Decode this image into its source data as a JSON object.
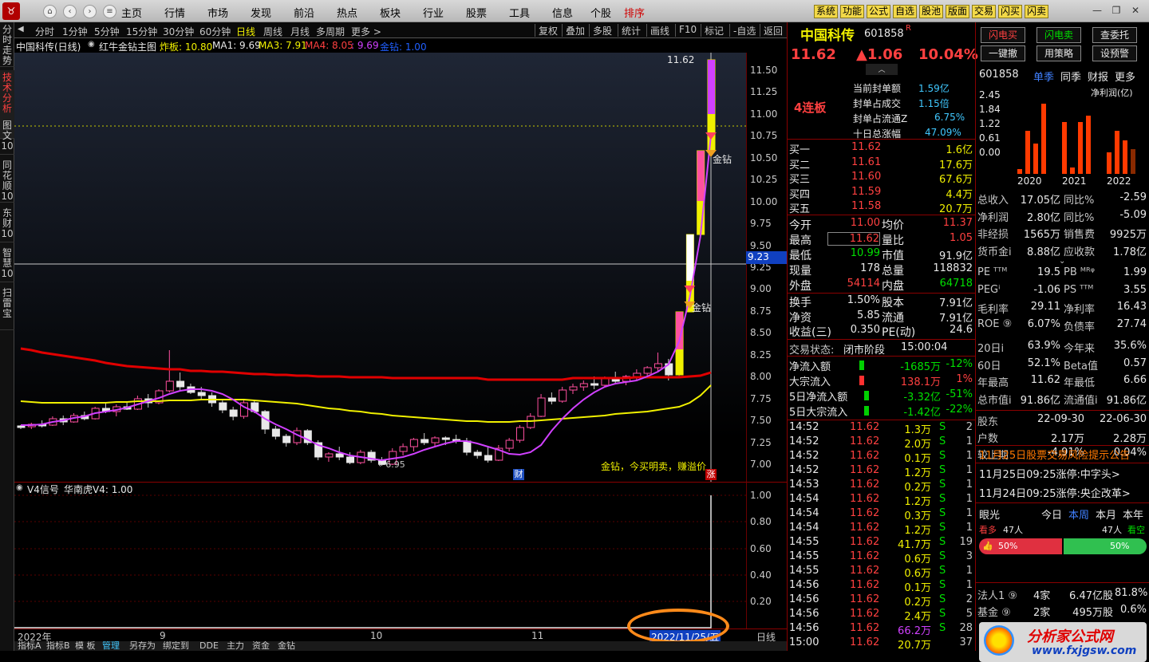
{
  "topbar": {
    "logo": "♉",
    "menus": [
      "主页",
      "行情",
      "市场",
      "发现",
      "前沿",
      "热点",
      "板块",
      "行业",
      "股票",
      "工具",
      "信息",
      "个股",
      "排序"
    ],
    "quick": [
      "系统",
      "功能",
      "公式",
      "自选",
      "股池",
      "版面",
      "交易",
      "闪买",
      "闪卖"
    ],
    "win_min": "—",
    "win_max": "❐",
    "win_close": "✕"
  },
  "sidebar": {
    "tabs": [
      "分时走势",
      "技术分析",
      "图文10",
      "同花顺10",
      "东财10",
      "智慧10",
      "扫雷宝"
    ]
  },
  "chartbar": {
    "periods": [
      "分时",
      "1分钟",
      "5分钟",
      "15分钟",
      "30分钟",
      "60分钟",
      "日线",
      "周线",
      "月线",
      "多周期",
      "更多 >"
    ],
    "tools": [
      "复权",
      "叠加",
      "多股",
      "统计",
      "画线",
      "F10",
      "标记",
      "-自选",
      "返回"
    ]
  },
  "infobar": {
    "stock": "中国科传(日线)",
    "indicator": "红牛金钻主图",
    "zb": "炸板: 10.80",
    "ma1": "MA1: 9.69",
    "ma3": "MA3: 7.91",
    "ma4": "MA4: 8.05",
    "ma4b": ": 9.69",
    "jz": "金钻: 1.00"
  },
  "chart_data": [
    {
      "type": "candlestick",
      "title": "中国科传(日线)",
      "ylim": [
        6.8,
        11.7
      ],
      "y_ticks": [
        "11.50",
        "11.25",
        "11.00",
        "10.75",
        "10.50",
        "10.25",
        "10.00",
        "9.75",
        "9.50",
        "9.25",
        "9.00",
        "8.75",
        "8.50",
        "8.25",
        "8.00",
        "7.75",
        "7.50",
        "7.25",
        "7.00"
      ],
      "x_ticks": [
        "2022年",
        "9",
        "10",
        "11",
        "2022/11/25/五"
      ],
      "ohlc": [
        [
          7.44,
          7.45,
          7.4,
          7.43
        ],
        [
          7.43,
          7.47,
          7.4,
          7.46
        ],
        [
          7.46,
          7.5,
          7.42,
          7.45
        ],
        [
          7.45,
          7.55,
          7.44,
          7.52
        ],
        [
          7.52,
          7.56,
          7.45,
          7.48
        ],
        [
          7.48,
          7.58,
          7.47,
          7.56
        ],
        [
          7.56,
          7.6,
          7.5,
          7.52
        ],
        [
          7.52,
          7.66,
          7.51,
          7.64
        ],
        [
          7.64,
          7.7,
          7.58,
          7.6
        ],
        [
          7.6,
          7.68,
          7.55,
          7.66
        ],
        [
          7.66,
          7.72,
          7.62,
          7.63
        ],
        [
          7.63,
          7.78,
          7.62,
          7.75
        ],
        [
          7.75,
          7.8,
          7.65,
          7.7
        ],
        [
          7.7,
          7.86,
          7.68,
          7.84
        ],
        [
          7.84,
          8.3,
          7.82,
          7.95
        ],
        [
          7.95,
          8.05,
          7.85,
          7.88
        ],
        [
          7.88,
          7.92,
          7.8,
          7.82
        ],
        [
          7.82,
          7.88,
          7.75,
          7.78
        ],
        [
          7.78,
          7.82,
          7.66,
          7.7
        ],
        [
          7.7,
          7.74,
          7.58,
          7.62
        ],
        [
          7.62,
          7.66,
          7.5,
          7.55
        ],
        [
          7.55,
          7.75,
          7.52,
          7.7
        ],
        [
          7.7,
          7.74,
          7.58,
          7.6
        ],
        [
          7.6,
          7.62,
          7.35,
          7.4
        ],
        [
          7.4,
          7.44,
          7.28,
          7.32
        ],
        [
          7.32,
          7.35,
          7.2,
          7.25
        ],
        [
          7.25,
          7.42,
          7.22,
          7.38
        ],
        [
          7.38,
          7.4,
          7.22,
          7.25
        ],
        [
          7.25,
          7.27,
          7.05,
          7.08
        ],
        [
          7.08,
          7.14,
          7.03,
          7.12
        ],
        [
          7.12,
          7.2,
          7.05,
          7.08
        ],
        [
          7.08,
          7.14,
          7.0,
          7.02
        ],
        [
          7.02,
          7.16,
          7.0,
          7.14
        ],
        [
          7.14,
          7.16,
          7.02,
          7.05
        ],
        [
          7.05,
          7.08,
          6.98,
          7.0
        ],
        [
          7.0,
          7.18,
          6.99,
          7.15
        ],
        [
          7.15,
          7.24,
          7.1,
          7.2
        ],
        [
          7.2,
          7.3,
          7.15,
          7.28
        ],
        [
          7.28,
          7.36,
          7.22,
          7.25
        ],
        [
          7.25,
          7.32,
          7.2,
          7.3
        ],
        [
          7.3,
          7.32,
          7.22,
          7.28
        ],
        [
          7.28,
          7.34,
          7.24,
          7.26
        ],
        [
          7.26,
          7.3,
          7.1,
          7.14
        ],
        [
          7.14,
          7.16,
          7.06,
          7.1
        ],
        [
          7.1,
          7.2,
          7.02,
          7.05
        ],
        [
          7.05,
          7.22,
          7.04,
          7.18
        ],
        [
          7.18,
          7.3,
          7.15,
          7.27
        ],
        [
          7.27,
          7.45,
          7.25,
          7.42
        ],
        [
          7.42,
          7.58,
          7.4,
          7.55
        ],
        [
          7.55,
          7.8,
          7.54,
          7.76
        ],
        [
          7.76,
          7.82,
          7.68,
          7.72
        ],
        [
          7.72,
          7.88,
          7.7,
          7.85
        ],
        [
          7.85,
          7.92,
          7.8,
          7.88
        ],
        [
          7.88,
          7.96,
          7.84,
          7.92
        ],
        [
          7.92,
          8.0,
          7.86,
          7.9
        ],
        [
          7.9,
          8.0,
          7.88,
          7.98
        ],
        [
          7.98,
          8.06,
          7.92,
          7.95
        ],
        [
          7.95,
          8.02,
          7.9,
          8.0
        ],
        [
          8.0,
          8.08,
          7.95,
          8.04
        ],
        [
          8.04,
          8.12,
          8.0,
          8.1
        ],
        [
          8.1,
          8.28,
          8.06,
          8.15
        ],
        [
          8.15,
          8.2,
          7.96,
          8.02
        ],
        [
          8.02,
          8.74,
          8.0,
          8.74
        ],
        [
          8.74,
          9.62,
          8.74,
          9.62
        ],
        [
          9.62,
          10.58,
          10.25,
          10.58
        ],
        [
          10.58,
          11.62,
          10.99,
          11.62
        ]
      ],
      "ma_red": [
        8.32,
        8.3,
        8.28,
        8.26,
        8.24,
        8.22,
        8.2,
        8.18,
        8.16,
        8.14,
        8.12,
        8.11,
        8.1,
        8.09,
        8.08,
        8.08,
        8.07,
        8.07,
        8.06,
        8.06,
        8.05,
        8.04,
        8.03,
        8.03,
        8.02,
        8.02,
        8.01,
        8.01,
        8.0,
        8.0,
        8.0,
        7.99,
        7.99,
        7.99,
        7.99,
        7.98,
        7.98,
        7.98,
        7.98,
        7.98,
        7.98,
        7.98,
        7.98,
        7.98,
        7.97,
        7.97,
        7.97,
        7.97,
        7.97,
        7.97,
        7.97,
        7.97,
        7.98,
        7.98,
        7.98,
        7.98,
        7.98,
        7.98,
        7.99,
        7.99,
        7.99,
        7.99,
        7.99,
        8.0,
        8.01,
        8.05
      ],
      "ma_yellow": [
        7.72,
        7.71,
        7.7,
        7.7,
        7.7,
        7.7,
        7.7,
        7.7,
        7.7,
        7.71,
        7.71,
        7.72,
        7.72,
        7.72,
        7.73,
        7.73,
        7.73,
        7.74,
        7.74,
        7.74,
        7.74,
        7.74,
        7.73,
        7.72,
        7.71,
        7.7,
        7.69,
        7.67,
        7.66,
        7.64,
        7.63,
        7.61,
        7.6,
        7.58,
        7.57,
        7.56,
        7.55,
        7.54,
        7.53,
        7.52,
        7.51,
        7.5,
        7.49,
        7.49,
        7.48,
        7.48,
        7.48,
        7.49,
        7.49,
        7.5,
        7.51,
        7.52,
        7.53,
        7.54,
        7.55,
        7.56,
        7.57,
        7.58,
        7.59,
        7.6,
        7.62,
        7.64,
        7.66,
        7.7,
        7.78,
        7.9
      ],
      "ma_white": [
        7.45,
        7.45,
        7.46,
        7.48,
        7.5,
        7.53,
        7.55,
        7.58,
        7.6,
        7.62,
        7.65,
        7.68,
        7.72,
        7.76,
        7.8,
        7.84,
        7.86,
        7.86,
        7.84,
        7.8,
        7.74,
        7.66,
        7.6,
        7.52,
        7.46,
        7.4,
        7.34,
        7.28,
        7.22,
        7.18,
        7.14,
        7.1,
        7.08,
        7.06,
        7.05,
        7.06,
        7.08,
        7.12,
        7.16,
        7.2,
        7.24,
        7.26,
        7.26,
        7.24,
        7.2,
        7.16,
        7.12,
        7.11,
        7.14,
        7.22,
        7.38,
        7.52,
        7.64,
        7.74,
        7.82,
        7.88,
        7.92,
        7.94,
        7.96,
        8.0,
        8.06,
        8.14,
        8.4,
        8.9,
        9.6,
        10.75
      ],
      "annotations": [
        "金钻，今买明卖，赚溢价",
        "11.62",
        "6.95",
        "金钻",
        "金钻",
        "财",
        "涨",
        "9.23"
      ]
    },
    {
      "type": "line",
      "title": "V4信号 华南虎V4: 1.00",
      "ylim": [
        0,
        1.05
      ],
      "y_ticks": [
        "1.00",
        "0.80",
        "0.60",
        "0.40",
        "0.20"
      ],
      "values_last": [
        0,
        0,
        1.0
      ]
    }
  ],
  "subinfo": {
    "name": "V4信号",
    "label": "华南虎V4: 1.00"
  },
  "bottom_tabs": [
    "指标A",
    "指标B",
    "模 板",
    "管理",
    "另存为",
    "绑定到",
    "DDE",
    "主力",
    "资金",
    "金钻"
  ],
  "quote": {
    "name": "中国科传",
    "code": "601858",
    "r": "R",
    "price": "11.62",
    "change": "▲1.06",
    "pct": "10.04%",
    "limit": "4连板",
    "limit_info": [
      [
        "当前封单额",
        "1.59亿"
      ],
      [
        "封单占成交",
        "1.15倍"
      ],
      [
        "封单占流通Z",
        "6.75%"
      ],
      [
        "十日总涨幅",
        "47.09%"
      ]
    ],
    "bids": [
      [
        "买一",
        "11.62",
        "1.6亿"
      ],
      [
        "买二",
        "11.61",
        "17.6万"
      ],
      [
        "买三",
        "11.60",
        "67.6万"
      ],
      [
        "买四",
        "11.59",
        "4.4万"
      ],
      [
        "买五",
        "11.58",
        "20.7万"
      ]
    ],
    "stats": [
      [
        "今开",
        "11.00",
        "均价",
        "11.37"
      ],
      [
        "最高",
        "11.62",
        "量比",
        "1.05"
      ],
      [
        "最低",
        "10.99",
        "市值",
        "91.9亿"
      ],
      [
        "现量",
        "178",
        "总量",
        "118832"
      ],
      [
        "外盘",
        "54114",
        "内盘",
        "64718"
      ]
    ],
    "stats2": [
      [
        "换手",
        "1.50%",
        "股本",
        "7.91亿"
      ],
      [
        "净资",
        "5.85",
        "流通",
        "7.91亿"
      ],
      [
        "收益(三)",
        "0.350",
        "PE(动)",
        "24.6"
      ]
    ],
    "trade_state_label": "交易状态:",
    "trade_state": "闭市阶段",
    "trade_time": "15:00:04",
    "flows": [
      [
        "净流入额",
        "-1685万",
        "-12%"
      ],
      [
        "大宗流入",
        "138.1万",
        "1%"
      ],
      [
        "5日净流入额",
        "-3.32亿",
        "-51%"
      ],
      [
        "5日大宗流入",
        "-1.42亿",
        "-22%"
      ]
    ],
    "ticks": [
      [
        "14:52",
        "11.62",
        "1.3万",
        "S",
        "2"
      ],
      [
        "14:52",
        "11.62",
        "2.0万",
        "S",
        "1"
      ],
      [
        "14:52",
        "11.62",
        "0.1万",
        "S",
        "1"
      ],
      [
        "14:52",
        "11.62",
        "1.2万",
        "S",
        "1"
      ],
      [
        "14:53",
        "11.62",
        "0.2万",
        "S",
        "1"
      ],
      [
        "14:54",
        "11.62",
        "1.2万",
        "S",
        "1"
      ],
      [
        "14:54",
        "11.62",
        "0.3万",
        "S",
        "1"
      ],
      [
        "14:54",
        "11.62",
        "1.2万",
        "S",
        "1"
      ],
      [
        "14:55",
        "11.62",
        "41.7万",
        "S",
        "19"
      ],
      [
        "14:55",
        "11.62",
        "0.6万",
        "S",
        "3"
      ],
      [
        "14:55",
        "11.62",
        "0.6万",
        "S",
        "1"
      ],
      [
        "14:56",
        "11.62",
        "0.1万",
        "S",
        "1"
      ],
      [
        "14:56",
        "11.62",
        "0.2万",
        "S",
        "2"
      ],
      [
        "14:56",
        "11.62",
        "2.4万",
        "S",
        "5"
      ],
      [
        "14:56",
        "11.62",
        "66.2万",
        "S",
        "28"
      ],
      [
        "15:00",
        "11.62",
        "20.7万",
        "",
        "37"
      ]
    ]
  },
  "f10": {
    "buttons": [
      "闪电买",
      "闪电卖",
      "查委托",
      "一键撤",
      "用策略",
      "设预警"
    ],
    "code": "601858",
    "tabs": [
      "单季",
      "同季",
      "财报",
      "更多"
    ],
    "chart_yticks": [
      "2.45",
      "1.84",
      "1.22",
      "0.61",
      "0.00"
    ],
    "chart_title": "净利润(亿)",
    "chart_x": [
      "2020",
      "2021",
      "2022"
    ],
    "bars": [
      0.15,
      1.4,
      1.0,
      2.3,
      1.7,
      0.2,
      1.7,
      1.9,
      0.7,
      1.4,
      1.1,
      0.8
    ],
    "rows": [
      [
        "总收入",
        "17.05亿",
        "同比%",
        "-2.59"
      ],
      [
        "净利润",
        "2.80亿",
        "同比%",
        "-5.09"
      ],
      [
        "非经损",
        "1565万",
        "销售费",
        "9925万"
      ],
      [
        "货币金i",
        "8.88亿",
        "应收款",
        "1.78亿"
      ]
    ],
    "rows2": [
      [
        "PE ᵀᵀᴹ",
        "19.5",
        "PB ᴹᴿᵠ",
        "1.99"
      ],
      [
        "PEGⁱ",
        "-1.06",
        "PS ᵀᵀᴹ",
        "3.55"
      ],
      [
        "毛利率",
        "29.11",
        "净利率",
        "16.43"
      ],
      [
        "ROE ⑨",
        "6.07%",
        "负债率",
        "27.74"
      ]
    ],
    "rows3": [
      [
        "20日i",
        "63.9%",
        "今年来",
        "35.6%"
      ],
      [
        "60日",
        "52.1%",
        "Beta值",
        "0.57"
      ],
      [
        "年最高",
        "11.62",
        "年最低",
        "6.66"
      ],
      [
        "总市值i",
        "91.86亿",
        "流通值i",
        "91.86亿"
      ]
    ],
    "holders": [
      [
        "股东",
        "22-09-30",
        "22-06-30"
      ],
      [
        "户数",
        "2.17万",
        "2.28万"
      ],
      [
        "较上期",
        "-4.91%",
        "0.04%"
      ]
    ],
    "notice": "11月25日股票交易风险提示公告",
    "news": [
      "11月25日09:25涨停:中字头>",
      "11月24日09:25涨停:央企改革>"
    ],
    "eye": {
      "label": "眼光",
      "tabs": [
        "今日",
        "本周",
        "本月",
        "本年"
      ],
      "bull": "看多",
      "bull_n": "47人",
      "bear_n": "47人",
      "bear": "看空",
      "pct_l": "50%",
      "pct_r": "50%"
    },
    "inst": [
      [
        "法人1 ⑨",
        "4家",
        "6.47亿股",
        "81.8%"
      ],
      [
        "基金 ⑨",
        "2家",
        "495万股",
        "0.6%"
      ]
    ],
    "watermark": "分析家公式网",
    "watermark_url": "www.fxjgsw.com"
  }
}
